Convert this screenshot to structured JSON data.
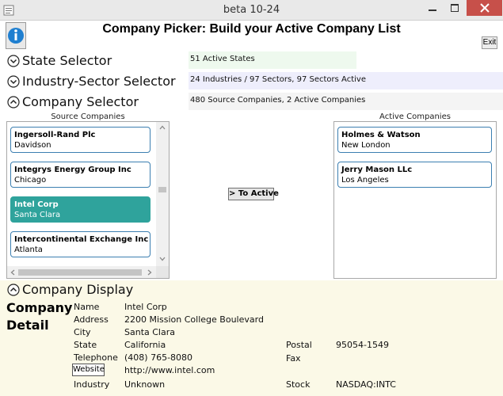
{
  "window": {
    "title": "beta 10-24"
  },
  "header": {
    "title": "Company Picker: Build your Active Company List",
    "exit_label": "Exit"
  },
  "sections": {
    "state": {
      "label": "State Selector",
      "info": "51 Active States"
    },
    "industry": {
      "label": "Industry-Sector Selector",
      "info": "24 Industries / 97 Sectors, 97 Sectors Active"
    },
    "company": {
      "label": "Company Selector",
      "info": "480 Source Companies, 2 Active Companies"
    },
    "display": {
      "label": "Company Display"
    }
  },
  "source": {
    "header": "Source Companies",
    "items": [
      {
        "name": "Ingersoll-Rand Plc",
        "city": "Davidson"
      },
      {
        "name": "Integrys Energy Group Inc",
        "city": "Chicago"
      },
      {
        "name": "Intel Corp",
        "city": "Santa Clara"
      },
      {
        "name": "Intercontinental Exchange Inc",
        "city": "Atlanta"
      }
    ]
  },
  "move_button": "> To Active",
  "active": {
    "header": "Active Companies",
    "items": [
      {
        "name": "Holmes & Watson",
        "city": "New London"
      },
      {
        "name": "Jerry Mason LLc",
        "city": "Los Angeles"
      }
    ]
  },
  "detail": {
    "heading_1": "Company",
    "heading_2": "Detail",
    "labels": {
      "name": "Name",
      "address": "Address",
      "city": "City",
      "state": "State",
      "telephone": "Telephone",
      "website": "Website",
      "industry": "Industry",
      "postal": "Postal",
      "fax": "Fax",
      "stock": "Stock"
    },
    "values": {
      "name": "Intel Corp",
      "address": "2200 Mission College Boulevard",
      "city": "Santa Clara",
      "state": "California",
      "telephone": "(408) 765-8080",
      "website": "http://www.intel.com",
      "industry": "Unknown",
      "postal": "95054-1549",
      "fax": "",
      "stock": "NASDAQ:INTC"
    }
  },
  "colors": {
    "selected_card": "#2fa39c",
    "card_border": "#3c7fb1",
    "close_button": "#c7504a",
    "state_info_bg": "#eef9ee",
    "industry_info_bg": "#eeeefc",
    "company_info_bg": "#f4f4f4",
    "display_bg": "#fbf9e7"
  }
}
